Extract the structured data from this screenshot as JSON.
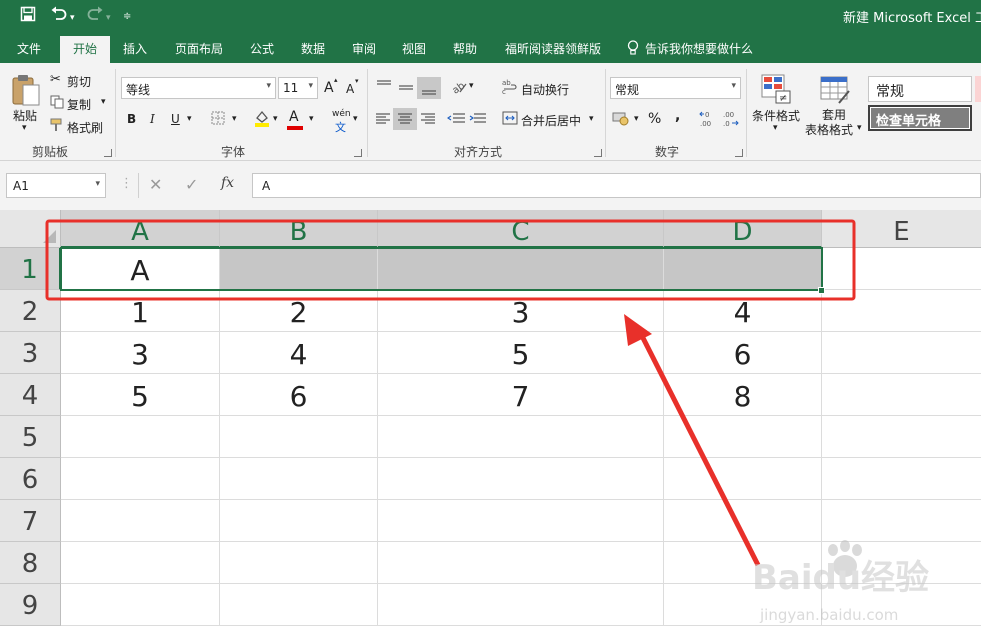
{
  "window": {
    "title": "新建 Microsoft Excel 工作表",
    "title_visible": "新建 Microsoft Excel 工作"
  },
  "ribbon_tabs": [
    "文件",
    "开始",
    "插入",
    "页面布局",
    "公式",
    "数据",
    "审阅",
    "视图",
    "帮助",
    "福昕阅读器领鲜版"
  ],
  "active_tab": "开始",
  "tell_me": "告诉我你想要做什么",
  "clipboard": {
    "paste": "粘贴",
    "cut": "剪切",
    "copy": "复制",
    "format_painter": "格式刷",
    "group": "剪贴板"
  },
  "font": {
    "name": "等线",
    "size": "11",
    "bold": "B",
    "italic": "I",
    "underline": "U",
    "grow": "A",
    "shrink": "A",
    "font_color": "A",
    "phonetic": "wén",
    "phonetic_sub": "文",
    "group": "字体"
  },
  "alignment": {
    "wrap": "自动换行",
    "merge": "合并后居中",
    "group": "对齐方式"
  },
  "number": {
    "format": "常规",
    "percent": "%",
    "comma": ",",
    "inc_decimal": ".00",
    "dec_decimal": ".00",
    "group": "数字"
  },
  "styles": {
    "conditional": "条件格式",
    "table_format_1": "套用",
    "table_format_2": "表格格式",
    "style_normal": "常规",
    "style_check": "检查单元格"
  },
  "formula_bar": {
    "name_box": "A1",
    "fx": "fx",
    "content": "A"
  },
  "sheet": {
    "columns": [
      "A",
      "B",
      "C",
      "D",
      "E"
    ],
    "rows": [
      "1",
      "2",
      "3",
      "4",
      "5",
      "6",
      "7",
      "8",
      "9"
    ],
    "cells": [
      [
        "A",
        "",
        "",
        "",
        ""
      ],
      [
        "1",
        "2",
        "3",
        "4",
        ""
      ],
      [
        "3",
        "4",
        "5",
        "6",
        ""
      ],
      [
        "5",
        "6",
        "7",
        "8",
        ""
      ],
      [
        "",
        "",
        "",
        "",
        ""
      ],
      [
        "",
        "",
        "",
        "",
        ""
      ],
      [
        "",
        "",
        "",
        "",
        ""
      ],
      [
        "",
        "",
        "",
        "",
        ""
      ],
      [
        "",
        "",
        "",
        "",
        ""
      ]
    ],
    "selection": "A1:D1"
  },
  "watermark": {
    "brand": "Baidu经验",
    "url": "jingyan.baidu.com"
  },
  "colors": {
    "excel_green": "#217346",
    "annotation_red": "#e8302a"
  }
}
